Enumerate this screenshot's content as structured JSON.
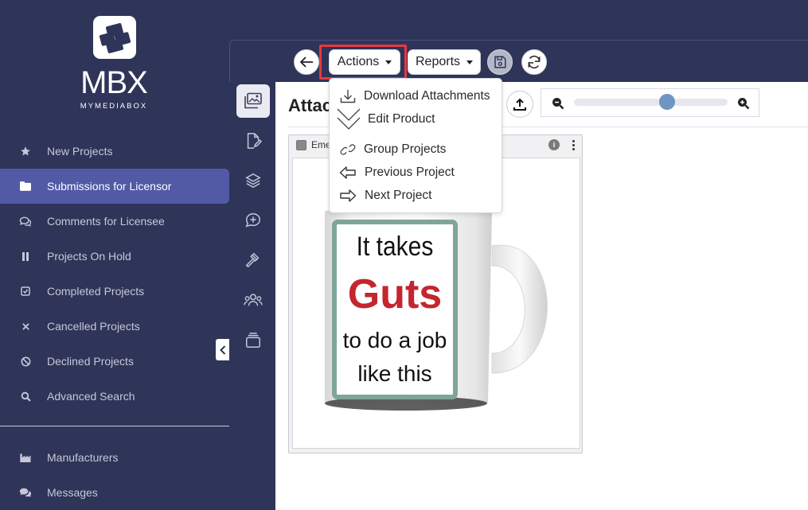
{
  "brand": {
    "name": "MBX",
    "tagline": "MYMEDIABOX"
  },
  "sidebar": {
    "items": [
      {
        "label": "New Projects",
        "icon": "star-icon"
      },
      {
        "label": "Submissions for Licensor",
        "icon": "folder-icon",
        "active": true
      },
      {
        "label": "Comments for Licensee",
        "icon": "comments-icon"
      },
      {
        "label": "Projects On Hold",
        "icon": "pause-icon"
      },
      {
        "label": "Completed Projects",
        "icon": "check-square-icon"
      },
      {
        "label": "Cancelled Projects",
        "icon": "x-icon"
      },
      {
        "label": "Declined Projects",
        "icon": "ban-icon"
      },
      {
        "label": "Advanced Search",
        "icon": "search-icon"
      }
    ],
    "bottom_items": [
      {
        "label": "Manufacturers",
        "icon": "industry-icon"
      },
      {
        "label": "Messages",
        "icon": "chat-icon"
      }
    ]
  },
  "toolbar": {
    "actions_label": "Actions",
    "reports_label": "Reports"
  },
  "actions_menu": {
    "items": [
      {
        "label": "Download Attachments",
        "icon": "download-icon"
      },
      {
        "label": "Edit Product",
        "icon": "chevron-down-icon"
      },
      {
        "label": "Group Projects",
        "icon": "link-icon"
      },
      {
        "label": "Previous Project",
        "icon": "arrow-left-icon"
      },
      {
        "label": "Next Project",
        "icon": "arrow-right-icon"
      }
    ]
  },
  "content": {
    "title": "Attac",
    "zoom_level": 0.62
  },
  "attachment": {
    "filename": "Eme",
    "info_label": "i",
    "mug_text": {
      "line1": "It takes",
      "line2": "Guts",
      "line3": "to do a job",
      "line4": "like this"
    }
  },
  "colors": {
    "sidebar_bg": "#2f3459",
    "active_item": "#525aa6",
    "highlight": "#e8393f",
    "mug_accent": "#c4262e",
    "mug_border": "#7fa59b"
  }
}
